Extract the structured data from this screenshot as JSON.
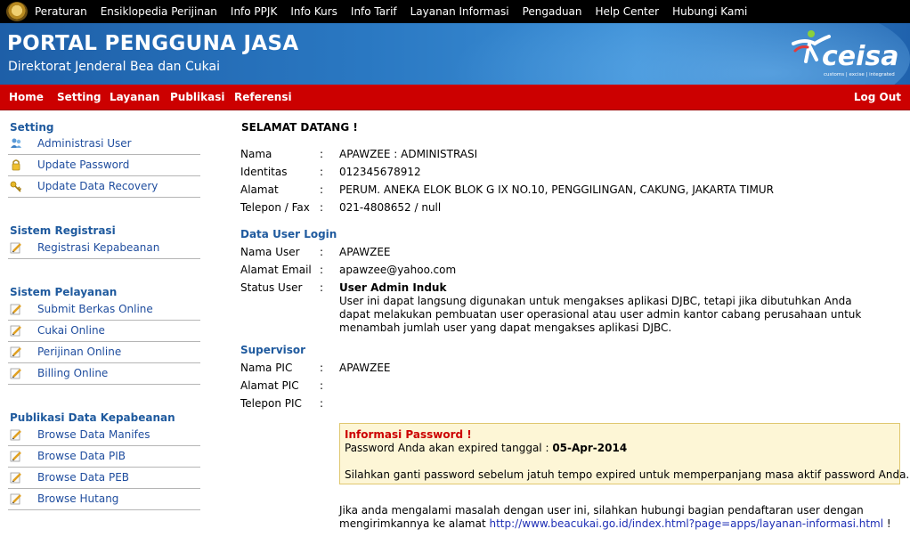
{
  "topnav": {
    "items": [
      "Peraturan",
      "Ensiklopedia Perijinan",
      "Info PPJK",
      "Info Kurs",
      "Info Tarif",
      "Layanan Informasi",
      "Pengaduan",
      "Help Center",
      "Hubungi Kami"
    ]
  },
  "banner": {
    "title": "PORTAL PENGGUNA JASA",
    "subtitle": "Direktorat Jenderal Bea dan Cukai",
    "logo_text": "ceisa",
    "logo_tagline": "customs | excise | integrated"
  },
  "menu": {
    "items": [
      "Home",
      "Setting",
      "Layanan",
      "Publikasi",
      "Referensi"
    ],
    "logout": "Log Out"
  },
  "sidebar": {
    "sections": [
      {
        "title": "Setting",
        "items": [
          {
            "label": "Administrasi User",
            "icon": "users-icon"
          },
          {
            "label": "Update Password",
            "icon": "lock-icon"
          },
          {
            "label": "Update Data Recovery",
            "icon": "key-icon"
          }
        ]
      },
      {
        "title": "Sistem Registrasi",
        "items": [
          {
            "label": "Registrasi Kepabeanan",
            "icon": "edit-icon"
          }
        ]
      },
      {
        "title": "Sistem Pelayanan",
        "items": [
          {
            "label": "Submit Berkas Online",
            "icon": "edit-icon"
          },
          {
            "label": "Cukai Online",
            "icon": "edit-icon"
          },
          {
            "label": "Perijinan Online",
            "icon": "edit-icon"
          },
          {
            "label": "Billing Online",
            "icon": "edit-icon"
          }
        ]
      },
      {
        "title": "Publikasi Data Kepabeanan",
        "items": [
          {
            "label": "Browse Data Manifes",
            "icon": "edit-icon"
          },
          {
            "label": "Browse Data PIB",
            "icon": "edit-icon"
          },
          {
            "label": "Browse Data PEB",
            "icon": "edit-icon"
          },
          {
            "label": "Browse Hutang",
            "icon": "edit-icon"
          }
        ]
      }
    ]
  },
  "content": {
    "welcome": "SELAMAT DATANG !",
    "colon": ":",
    "profile": {
      "nama_label": "Nama",
      "nama_value": "APAWZEE : ADMINISTRASI",
      "identitas_label": "Identitas",
      "identitas_value": "012345678912",
      "alamat_label": "Alamat",
      "alamat_value": "PERUM. ANEKA ELOK BLOK G IX NO.10, PENGGILINGAN, CAKUNG, JAKARTA TIMUR",
      "telepon_label": "Telepon / Fax",
      "telepon_value": "021-4808652 / null"
    },
    "login": {
      "section_title": "Data User Login",
      "nama_user_label": "Nama User",
      "nama_user_value": "APAWZEE",
      "email_label": "Alamat Email",
      "email_value": "apawzee@yahoo.com",
      "status_label": "Status User",
      "status_value": "User Admin Induk",
      "status_desc": "User ini dapat langsung digunakan untuk mengakses aplikasi DJBC, tetapi jika dibutuhkan Anda dapat melakukan pembuatan user operasional atau user admin kantor cabang perusahaan untuk menambah jumlah user yang dapat mengakses aplikasi DJBC."
    },
    "supervisor": {
      "section_title": "Supervisor",
      "nama_pic_label": "Nama PIC",
      "nama_pic_value": "APAWZEE",
      "alamat_pic_label": "Alamat PIC",
      "telepon_pic_label": "Telepon PIC"
    },
    "password_info": {
      "title": "Informasi Password !",
      "line1_prefix": "Password Anda akan expired tanggal :",
      "expiry_date": "05-Apr-2014",
      "line2": "Silahkan ganti password sebelum jatuh tempo expired untuk memperpanjang masa aktif password Anda..."
    },
    "footer": {
      "line1": "Jika anda mengalami masalah dengan user ini, silahkan hubungi bagian pendaftaran user dengan",
      "line2_prefix": "mengirimkannya ke alamat",
      "link": "http://www.beacukai.go.id/index.html?page=apps/layanan-informasi.html",
      "suffix": "!"
    }
  },
  "colors": {
    "menu_red": "#cc0000",
    "banner_blue": "#2a78c2",
    "heading_blue": "#1f5a9e",
    "link_blue": "#1f2fb5",
    "info_bg": "#fdf6d6"
  }
}
